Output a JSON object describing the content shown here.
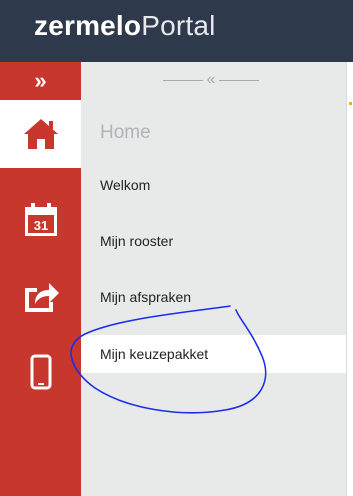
{
  "header": {
    "logo_bold": "zermelo",
    "logo_light": "Portal"
  },
  "rail": {
    "toggle_glyph": "»",
    "icons": [
      {
        "name": "home-icon",
        "active": true
      },
      {
        "name": "calendar-icon",
        "label": "31"
      },
      {
        "name": "share-icon"
      },
      {
        "name": "mobile-icon"
      }
    ]
  },
  "submenu": {
    "collapse_glyph": "«",
    "section_title": "Home",
    "items": [
      {
        "label": "Welkom"
      },
      {
        "label": "Mijn rooster"
      },
      {
        "label": "Mijn afspraken"
      },
      {
        "label": "Mijn keuzepakket",
        "selected": true
      }
    ]
  },
  "colors": {
    "header_bg": "#2e3a4b",
    "rail_bg": "#c8372d",
    "submenu_bg": "#e8eaea",
    "annotation_stroke": "#1a2ee8"
  }
}
